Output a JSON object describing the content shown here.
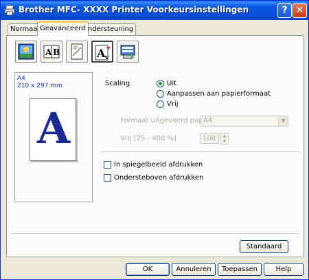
{
  "window": {
    "title": "Brother MFC- XXXX   Printer Voorkeursinstellingen",
    "help_button": "?",
    "close_button": "✕"
  },
  "tabs": [
    {
      "label": "Normaal",
      "active": false
    },
    {
      "label": "Geavanceerd",
      "active": true
    },
    {
      "label": "Ondersteuning",
      "active": false
    }
  ],
  "toolbar": {
    "icons": [
      "color-settings-icon",
      "duplex-booklet-icon",
      "watermark-icon",
      "scaling-icon",
      "device-options-icon"
    ],
    "selected_index": 3
  },
  "preview": {
    "paper_name": "A4",
    "paper_dimensions": "210 x 297 mm",
    "letter": "A"
  },
  "scaling": {
    "label": "Scaling",
    "options": [
      {
        "label": "Uit",
        "checked": true
      },
      {
        "label": "Aanpassen aan papierformaat",
        "checked": false
      },
      {
        "label": "Vrij",
        "checked": false
      }
    ],
    "output_paper_label": "Formaat uitgevoerd papier",
    "output_paper_value": "A4",
    "free_label": "Vrij [25 - 400 %]",
    "free_value": "100"
  },
  "options": {
    "mirror_label": "In spiegelbeeld afdrukken",
    "mirror_checked": false,
    "reverse_label": "Ondersteboven afdrukken",
    "reverse_checked": false
  },
  "buttons": {
    "default": "Standaard",
    "ok": "OK",
    "cancel": "Annuleren",
    "apply": "Toepassen",
    "help": "Help"
  },
  "colors": {
    "title_bar": "#0a5fe6",
    "dialog_bg": "#ece9d8",
    "panel_bg": "#fcfcfe",
    "disabled_text": "#a8a89a",
    "preview_text": "#1d33c8"
  }
}
